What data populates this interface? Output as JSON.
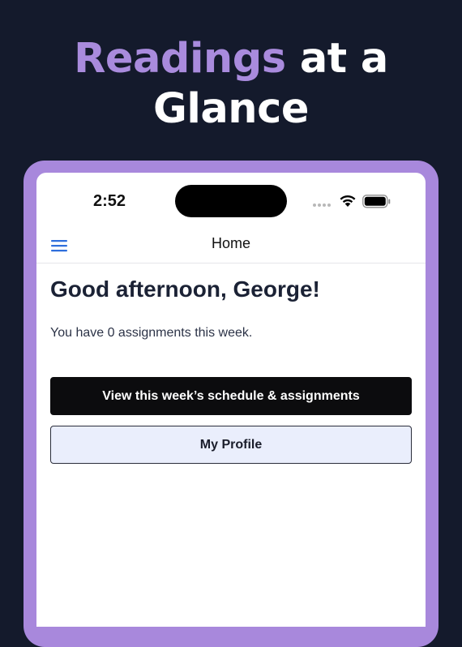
{
  "headline": {
    "accent": "Readings",
    "rest": "at a Glance"
  },
  "status_bar": {
    "time": "2:52"
  },
  "nav": {
    "title": "Home"
  },
  "main": {
    "greeting": "Good afternoon, George!",
    "summary": "You have 0 assignments this week.",
    "primary_button": "View this week’s schedule & assignments",
    "secondary_button": "My Profile"
  },
  "colors": {
    "background": "#141a2c",
    "accent": "#a98bdd",
    "frame": "#a888dc",
    "menu_icon": "#2f6fdc",
    "primary_button": "#0c0c0e",
    "secondary_button": "#eaeefc"
  },
  "icons": {
    "menu": "hamburger-menu-icon",
    "wifi": "wifi-icon",
    "battery": "battery-icon",
    "signal": "cellular-signal-icon"
  }
}
